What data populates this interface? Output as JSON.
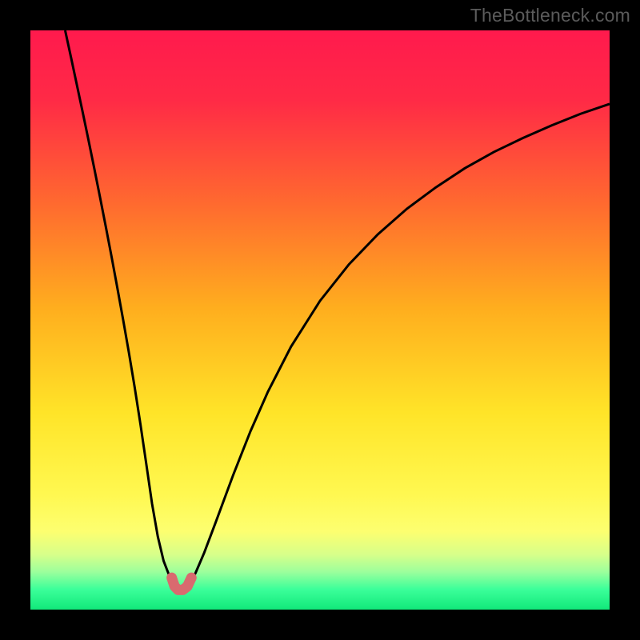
{
  "watermark": "TheBottleneck.com",
  "chart_data": {
    "type": "line",
    "title": "",
    "xlabel": "",
    "ylabel": "",
    "xlim": [
      0,
      100
    ],
    "ylim": [
      0,
      100
    ],
    "annotations": [],
    "gradient_stops": [
      {
        "pos": 0.0,
        "color": "#ff1a4d"
      },
      {
        "pos": 0.12,
        "color": "#ff2a46"
      },
      {
        "pos": 0.3,
        "color": "#ff6a2f"
      },
      {
        "pos": 0.48,
        "color": "#ffae1e"
      },
      {
        "pos": 0.66,
        "color": "#ffe428"
      },
      {
        "pos": 0.8,
        "color": "#fff850"
      },
      {
        "pos": 0.865,
        "color": "#fdff70"
      },
      {
        "pos": 0.905,
        "color": "#d7ff8a"
      },
      {
        "pos": 0.935,
        "color": "#9cff9c"
      },
      {
        "pos": 0.965,
        "color": "#3bff9a"
      },
      {
        "pos": 1.0,
        "color": "#12e87a"
      }
    ],
    "series": [
      {
        "name": "left-branch",
        "type": "curve",
        "stroke": "#000000",
        "stroke_width": 3,
        "x": [
          6,
          7,
          8,
          9,
          10,
          11,
          12,
          13,
          14,
          15,
          16,
          17,
          18,
          19,
          20,
          21,
          22,
          23,
          24,
          24.6
        ],
        "y": [
          100,
          95.4,
          90.7,
          86.0,
          81.2,
          76.3,
          71.3,
          66.2,
          61.0,
          55.6,
          50.1,
          44.4,
          38.4,
          32.0,
          25.2,
          18.3,
          12.6,
          8.4,
          5.8,
          4.8
        ]
      },
      {
        "name": "right-branch",
        "type": "curve",
        "stroke": "#000000",
        "stroke_width": 3,
        "x": [
          27.6,
          28.5,
          30,
          32,
          35,
          38,
          41,
          45,
          50,
          55,
          60,
          65,
          70,
          75,
          80,
          85,
          90,
          95,
          100
        ],
        "y": [
          4.8,
          6.3,
          9.8,
          15.1,
          23.2,
          30.8,
          37.6,
          45.4,
          53.3,
          59.6,
          64.8,
          69.2,
          72.9,
          76.2,
          79.0,
          81.4,
          83.6,
          85.6,
          87.3
        ]
      },
      {
        "name": "valley-marker",
        "type": "marker_path",
        "stroke": "#d96a6f",
        "stroke_width": 13,
        "x": [
          24.4,
          24.9,
          25.5,
          26.3,
          27.1,
          27.8
        ],
        "y": [
          5.5,
          4.0,
          3.4,
          3.4,
          4.0,
          5.5
        ]
      }
    ]
  }
}
